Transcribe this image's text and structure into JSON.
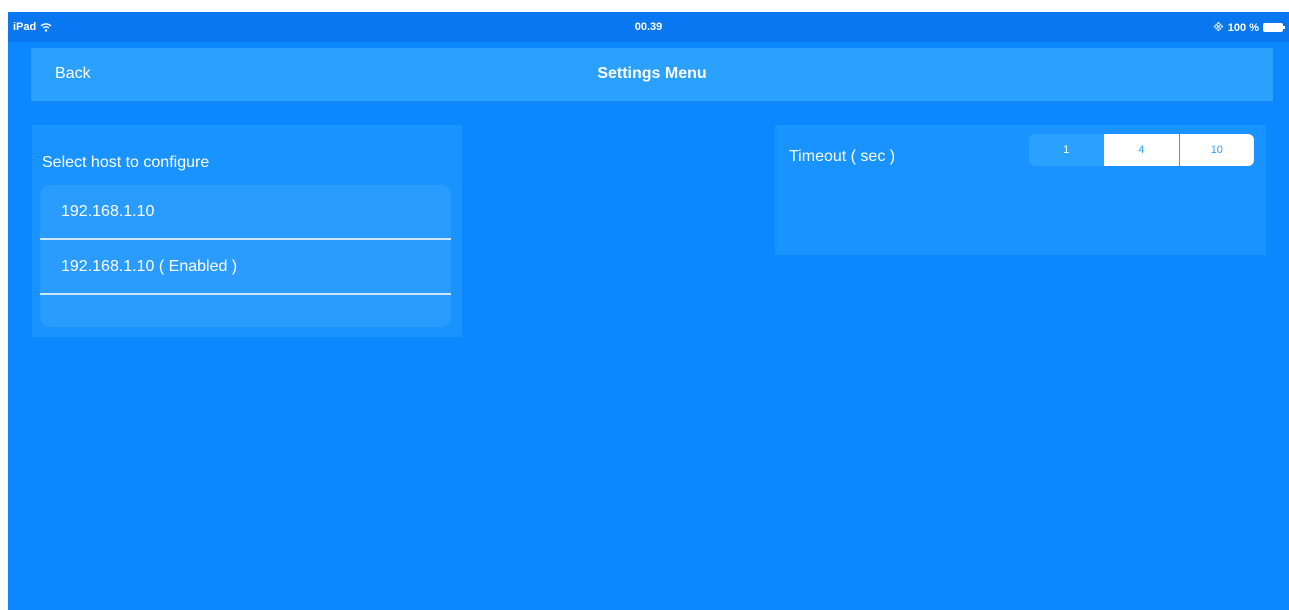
{
  "status_bar": {
    "device": "iPad",
    "time": "00.39",
    "battery": "100 %"
  },
  "nav": {
    "back_label": "Back",
    "title": "Settings Menu"
  },
  "hosts": {
    "label": "Select host to configure",
    "items": [
      {
        "label": "192.168.1.10"
      },
      {
        "label": "192.168.1.10 ( Enabled )"
      }
    ]
  },
  "timeout": {
    "label": "Timeout ( sec )",
    "options": [
      "1",
      "4",
      "10"
    ],
    "selected": "1"
  },
  "colors": {
    "background": "#0b87ff",
    "nav_bar": "#2aa0ff",
    "panel": "#1893ff",
    "text": "#ffffff"
  }
}
